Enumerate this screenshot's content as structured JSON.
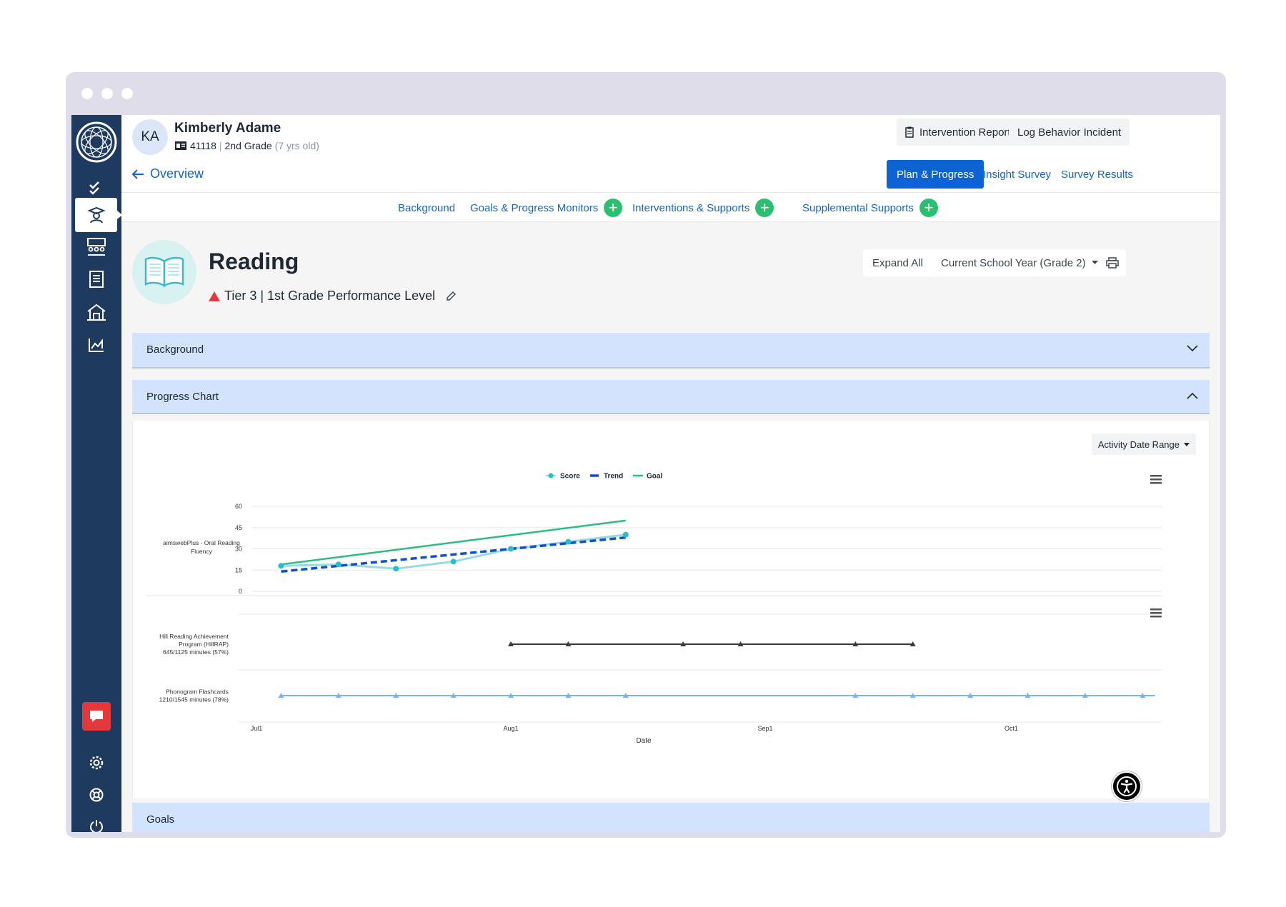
{
  "student": {
    "initials": "KA",
    "name": "Kimberly Adame",
    "id": "41118",
    "grade": "2nd Grade",
    "age": "(7 yrs old)"
  },
  "header_actions": {
    "intervention_report": "Intervention Report",
    "log_behavior": "Log Behavior Incident"
  },
  "nav": {
    "overview": "Overview",
    "tabs": [
      "Plan & Progress",
      "Insight Survey",
      "Survey Results"
    ],
    "active_tab": "Plan & Progress"
  },
  "subnav": {
    "background": "Background",
    "goals": "Goals & Progress Monitors",
    "interventions": "Interventions & Supports",
    "supplemental": "Supplemental Supports"
  },
  "subject": {
    "title": "Reading",
    "tier": "Tier 3 | 1st Grade Performance Level"
  },
  "controls": {
    "expand_all": "Expand All",
    "year_select": "Current School Year (Grade 2)"
  },
  "sections": {
    "background": "Background",
    "progress_chart": "Progress Chart",
    "goals": "Goals"
  },
  "chart_controls": {
    "date_range": "Activity Date Range"
  },
  "chart_data": {
    "type": "line",
    "legend": [
      "Score",
      "Trend",
      "Goal"
    ],
    "legend_placement": "top-center",
    "colors": {
      "score": "#97dbe2",
      "score_point": "#27bfd0",
      "trend": "#1150c9",
      "goal": "#2bbd7e",
      "hillrap": "#3a3a3a",
      "flashcards": "#7db3e8"
    },
    "xlabel": "Date",
    "x_ticks": [
      "Jul 1",
      "Aug 1",
      "Sep 1",
      "Oct 1"
    ],
    "x_range": [
      "Jul 1",
      "Oct 18"
    ],
    "top_panel": {
      "ylabel": "aimswebPlus - Oral Reading Fluency",
      "ylim": [
        0,
        60
      ],
      "y_ticks": [
        0,
        15,
        30,
        45,
        60
      ],
      "score": {
        "x": [
          "Jul 4",
          "Jul 11",
          "Jul 18",
          "Jul 25",
          "Aug 1",
          "Aug 8",
          "Aug 15"
        ],
        "values": [
          18,
          19,
          16,
          21,
          30,
          35,
          40
        ]
      },
      "trend": {
        "x": [
          "Jul 4",
          "Aug 15"
        ],
        "values": [
          14,
          38
        ]
      },
      "goal": {
        "x": [
          "Jul 4",
          "Aug 15"
        ],
        "values": [
          19,
          50
        ]
      }
    },
    "bottom_panel": {
      "series": [
        {
          "label_lines": [
            "Hill Reading Achievement",
            "Program (HillRAP)",
            "645/1125 minutes (57%)"
          ],
          "x": [
            "Aug 1",
            "Aug 8",
            "Aug 22",
            "Aug 29",
            "Sep 12",
            "Sep 19"
          ]
        },
        {
          "label_lines": [
            "Phonogram Flashcards",
            "1210/1545 minutes (78%)"
          ],
          "x": [
            "Jul 4",
            "Jul 11",
            "Jul 18",
            "Jul 25",
            "Aug 1",
            "Aug 8",
            "Aug 15",
            "Sep 12",
            "Sep 19",
            "Sep 26",
            "Oct 3",
            "Oct 10",
            "Oct 17"
          ]
        }
      ]
    }
  }
}
